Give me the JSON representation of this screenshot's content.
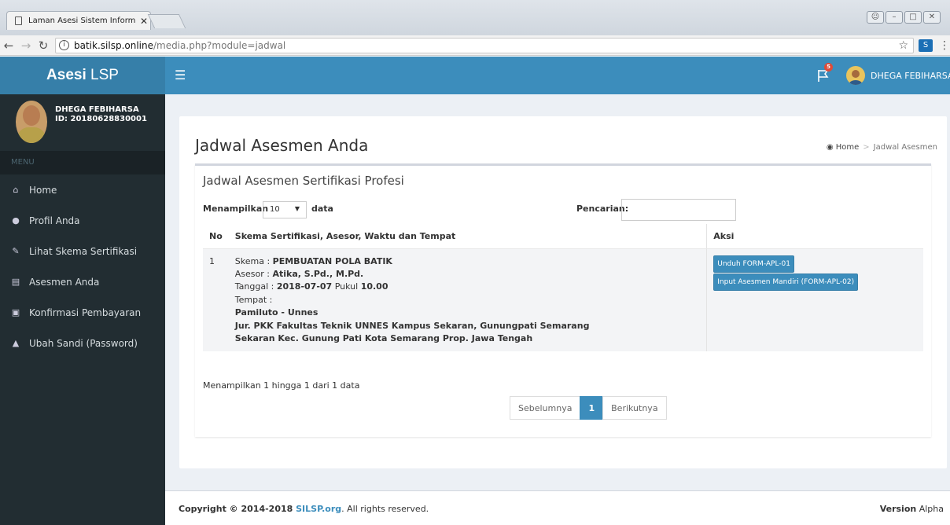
{
  "browser": {
    "tab_title": "Laman Asesi Sistem Inform",
    "tab_close": "✕",
    "url_host": "batik.silsp.online",
    "url_path": "/media.php?module=jadwal"
  },
  "header": {
    "logo_bold": "Asesi",
    "logo_rest": " LSP",
    "notification_count": "5",
    "user_name": "DHEGA FEBIHARSA"
  },
  "sidebar": {
    "user_name": "DHEGA FEBIHARSA",
    "user_id": "ID: 20180628830001",
    "menu_header": "MENU",
    "items": [
      {
        "label": "Home",
        "icon": "home-icon"
      },
      {
        "label": "Profil Anda",
        "icon": "user-icon"
      },
      {
        "label": "Lihat Skema Sertifikasi",
        "icon": "edit-icon"
      },
      {
        "label": "Asesmen Anda",
        "icon": "document-icon"
      },
      {
        "label": "Konfirmasi Pembayaran",
        "icon": "money-icon"
      },
      {
        "label": "Ubah Sandi (Password)",
        "icon": "lock-icon"
      }
    ]
  },
  "page": {
    "title": "Jadwal Asesmen Anda",
    "breadcrumb_home": "Home",
    "breadcrumb_current": "Jadwal Asesmen"
  },
  "box": {
    "title": "Jadwal Asesmen Sertifikasi Profesi",
    "length_label": "Menampilkan",
    "length_value": "10",
    "length_suffix": "data",
    "search_label": "Pencarian:"
  },
  "table": {
    "headers": [
      "No",
      "Skema Sertifikasi, Asesor, Waktu dan Tempat",
      "Aksi"
    ],
    "row": {
      "no": "1",
      "skema_label": "Skema : ",
      "skema_value": "PEMBUATAN POLA BATIK",
      "asesor_label": "Asesor : ",
      "asesor_value": "Atika, S.Pd., M.Pd.",
      "tanggal_label": "Tanggal : ",
      "tanggal_value": "2018-07-07",
      "pukul_label": " Pukul ",
      "pukul_value": "10.00",
      "tempat_label": "Tempat :",
      "tempat_line1": "Pamiluto - Unnes",
      "tempat_line2": "Jur. PKK Fakultas Teknik UNNES Kampus Sekaran, Gunungpati Semarang",
      "tempat_line3": "Sekaran Kec. Gunung Pati Kota Semarang Prop. Jawa Tengah",
      "btn_unduh": "Unduh FORM-APL-01",
      "btn_input": "Input Asesmen Mandiri (FORM-APL-02)"
    }
  },
  "pagination": {
    "info": "Menampilkan 1 hingga 1 dari 1 data",
    "prev": "Sebelumnya",
    "current": "1",
    "next": "Berikutnya"
  },
  "footer": {
    "copyright_prefix": "Copyright © 2014-2018 ",
    "brand": "SILSP.org",
    "copyright_suffix": ". All rights reserved.",
    "version_label": "Version",
    "version_value": " Alpha"
  }
}
